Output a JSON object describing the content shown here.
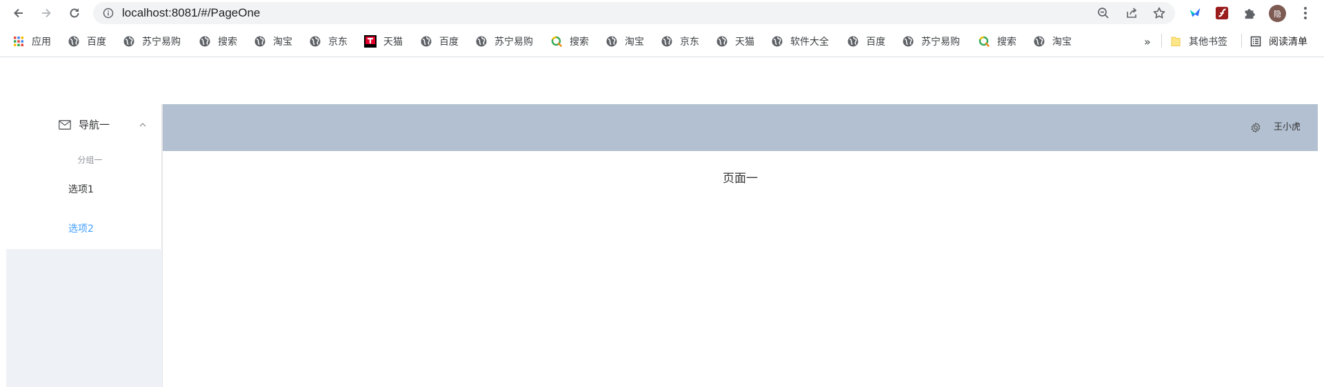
{
  "browser": {
    "url": "localhost:8081/#/PageOne",
    "avatar_text": "隐",
    "bookmarks": [
      {
        "label": "应用",
        "icon": "apps-grid-icon"
      },
      {
        "label": "百度",
        "icon": "globe-icon"
      },
      {
        "label": "苏宁易购",
        "icon": "globe-icon"
      },
      {
        "label": "搜索",
        "icon": "globe-icon"
      },
      {
        "label": "淘宝",
        "icon": "globe-icon"
      },
      {
        "label": "京东",
        "icon": "globe-icon"
      },
      {
        "label": "天猫",
        "icon": "tmall-icon"
      },
      {
        "label": "百度",
        "icon": "globe-icon"
      },
      {
        "label": "苏宁易购",
        "icon": "globe-icon"
      },
      {
        "label": "搜索",
        "icon": "search-engine-icon"
      },
      {
        "label": "淘宝",
        "icon": "globe-icon"
      },
      {
        "label": "京东",
        "icon": "globe-icon"
      },
      {
        "label": "天猫",
        "icon": "globe-icon"
      },
      {
        "label": "软件大全",
        "icon": "globe-icon"
      },
      {
        "label": "百度",
        "icon": "globe-icon"
      },
      {
        "label": "苏宁易购",
        "icon": "globe-icon"
      },
      {
        "label": "搜索",
        "icon": "search-engine-icon"
      },
      {
        "label": "淘宝",
        "icon": "globe-icon"
      }
    ],
    "overflow": "»",
    "other_bookmarks": "其他书签",
    "reading_list": "阅读清单"
  },
  "sidebar": {
    "submenu_title": "导航一",
    "group_title": "分组一",
    "items": [
      {
        "label": "选项1",
        "active": false
      },
      {
        "label": "选项2",
        "active": true
      }
    ]
  },
  "header": {
    "username": "王小虎"
  },
  "content": {
    "text": "页面一"
  },
  "colors": {
    "header_bg": "#b3c0d1",
    "aside_bg": "#eef1f6",
    "active": "#409eff"
  }
}
